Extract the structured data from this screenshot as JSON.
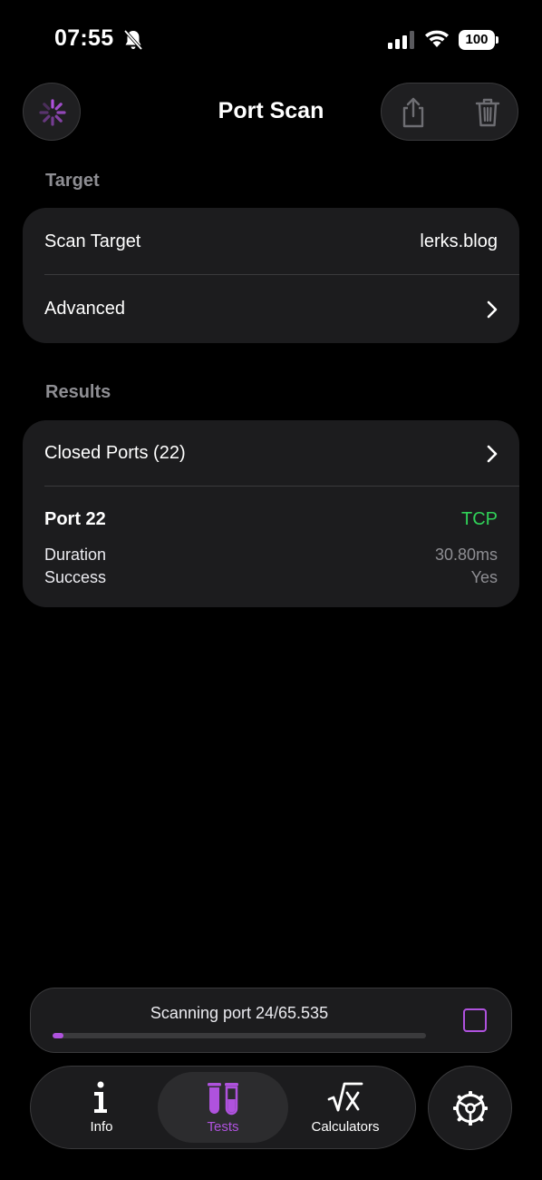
{
  "status_bar": {
    "time": "07:55",
    "battery": "100",
    "icons": [
      "bell-slash-icon",
      "signal-icon",
      "wifi-icon",
      "battery-icon"
    ]
  },
  "nav": {
    "title": "Port Scan",
    "left_icon": "spinner-icon",
    "right_icons": [
      "share-icon",
      "trash-icon"
    ]
  },
  "target_section": {
    "header": "Target",
    "scan_target_label": "Scan Target",
    "scan_target_value": "lerks.blog",
    "advanced_label": "Advanced"
  },
  "results_section": {
    "header": "Results",
    "closed_ports_label": "Closed Ports (22)",
    "port_title": "Port 22",
    "protocol": "TCP",
    "duration_label": "Duration",
    "duration_value": "30.80ms",
    "success_label": "Success",
    "success_value": "Yes"
  },
  "progress": {
    "text": "Scanning port 24/65.535",
    "fraction": 0.03
  },
  "tabs": [
    {
      "label": "Info",
      "icon": "info-icon",
      "active": false
    },
    {
      "label": "Tests",
      "icon": "test-tubes-icon",
      "active": true
    },
    {
      "label": "Calculators",
      "icon": "square-root-icon",
      "active": false
    }
  ],
  "settings_icon": "gear-icon",
  "colors": {
    "accent": "#af52de",
    "success": "#30d158",
    "background": "#000000",
    "card": "#1c1c1e",
    "secondary_text": "#8e8e93"
  }
}
